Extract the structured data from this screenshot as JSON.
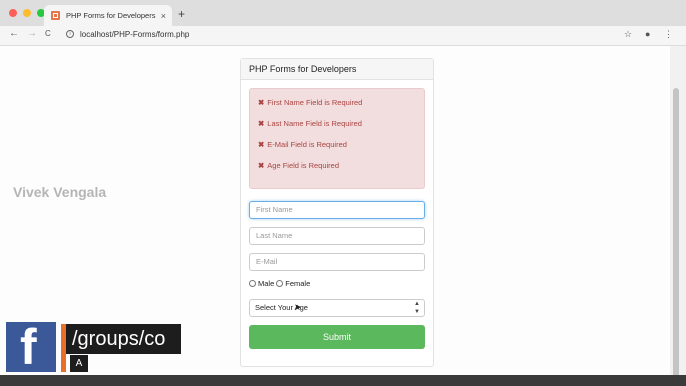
{
  "browser": {
    "tab_title": "PHP Forms for Developers",
    "tab_close": "×",
    "new_tab": "+",
    "back": "←",
    "forward": "→",
    "reload": "C",
    "url_host": "localhost",
    "url_path": "/PHP-Forms/form.php",
    "star": "☆",
    "account": "●",
    "menu": "⋮"
  },
  "watermark": "Vivek Vengala",
  "card": {
    "title": "PHP Forms for Developers",
    "errors": [
      "First Name Field is Required",
      "Last Name Field is Required",
      "E-Mail Field is Required",
      "Age Field is Required"
    ],
    "error_icon": "✖",
    "first_name_placeholder": "First Name",
    "last_name_placeholder": "Last Name",
    "email_placeholder": "E-Mail",
    "gender_male": "Male",
    "gender_female": "Female",
    "age_select": "Select Your Age",
    "submit": "Submit"
  },
  "overlay": {
    "fb_letter": "f",
    "text": "/groups/co",
    "sub": "A"
  },
  "colors": {
    "alert_bg": "#f2dede",
    "error_text": "#a94442",
    "submit_bg": "#5cb85c",
    "facebook": "#3b5998"
  }
}
